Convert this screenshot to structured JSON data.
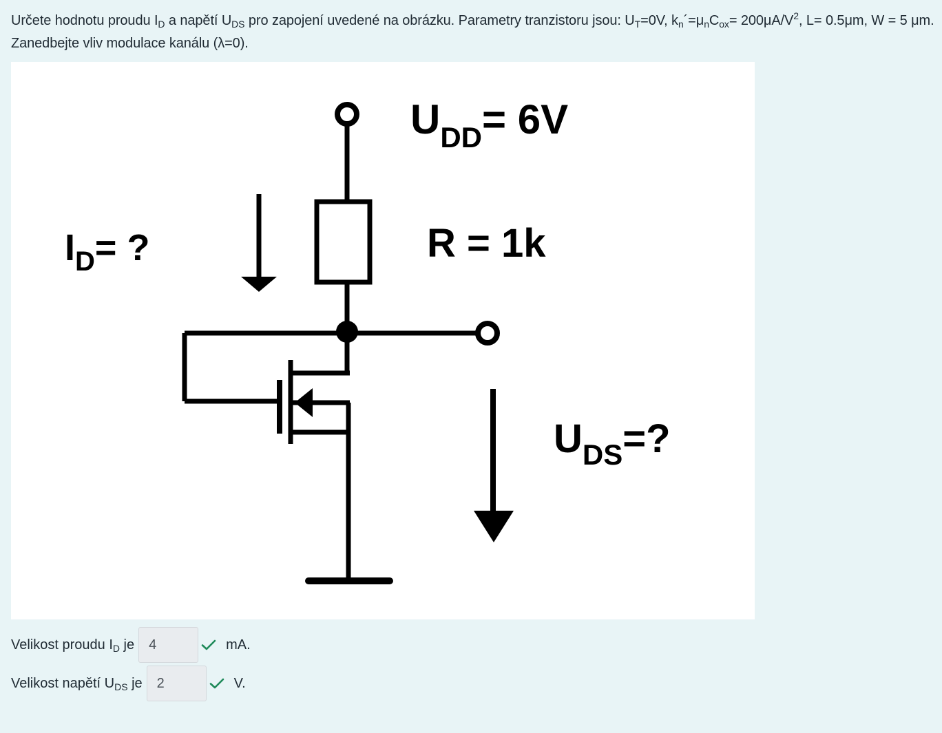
{
  "question": {
    "p1": "Určete hodnotu proudu I",
    "s1": "D",
    "p2": " a napětí U",
    "s2": "DS",
    "p3": " pro zapojení uvedené na obrázku. Parametry tranzistoru jsou: U",
    "s3": "T",
    "p4": "=0V, k",
    "s4": "n",
    "p4b": "´=μ",
    "s4b": "n",
    "p5": "C",
    "s5": "ox",
    "p6": "= 200μA/V",
    "sup6": "2",
    "p7": ", L= 0.5μm, W = 5 μm. Zanedbejte vliv modulace kanálu (λ=0)."
  },
  "figure": {
    "udd_main": "U",
    "udd_sub": "DD",
    "udd_value": "= 6V",
    "r_label": "R = 1k",
    "id_main": "I",
    "id_sub": "D",
    "id_value": "= ?",
    "uds_main": "U",
    "uds_sub": "DS",
    "uds_value": "=?"
  },
  "answers": [
    {
      "label": "Velikost proudu I",
      "label_sub": "D",
      "label_suffix": " je",
      "value": "4",
      "unit": "mA.",
      "status": "correct"
    },
    {
      "label": "Velikost napětí U",
      "label_sub": "DS",
      "label_suffix": " je",
      "value": "2",
      "unit": "V.",
      "status": "correct"
    }
  ],
  "colors": {
    "background": "#e8f4f6",
    "check": "#1f8a5a"
  }
}
